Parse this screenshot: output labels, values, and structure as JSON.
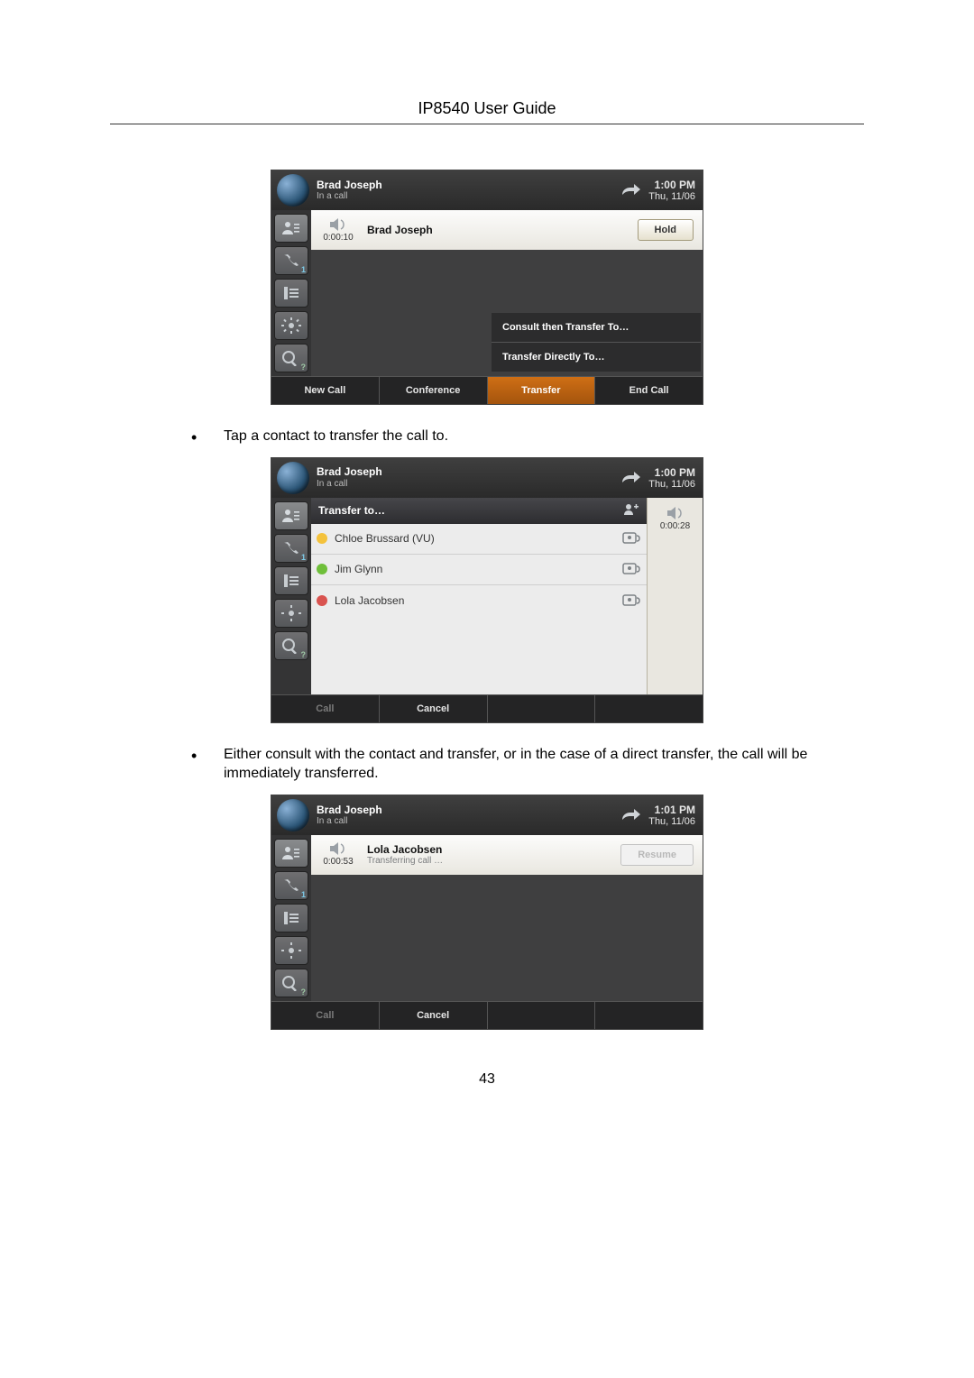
{
  "doc": {
    "title": "IP8540 User Guide",
    "page_number": "43",
    "bullet1": "Tap a contact to transfer the call to.",
    "bullet2": "Either consult with the contact and transfer, or in the case of a direct transfer, the call will be immediately transferred."
  },
  "s1": {
    "presence_name": "Brad Joseph",
    "presence_status": "In a call",
    "time": "1:00 PM",
    "date": "Thu, 11/06",
    "call_timer": "0:00:10",
    "call_name": "Brad Joseph",
    "hold_label": "Hold",
    "menu": {
      "item1": "Consult then Transfer To…",
      "item2": "Transfer Directly To…"
    },
    "softkeys": {
      "k1": "New Call",
      "k2": "Conference",
      "k3": "Transfer",
      "k4": "End Call"
    }
  },
  "s2": {
    "presence_name": "Brad Joseph",
    "presence_status": "In a call",
    "time": "1:00 PM",
    "date": "Thu, 11/06",
    "panel_title": "Transfer to…",
    "call_timer": "0:00:28",
    "contacts": [
      {
        "name": "Chloe Brussard (VU)",
        "status": "away"
      },
      {
        "name": "Jim Glynn",
        "status": "avail"
      },
      {
        "name": "Lola Jacobsen",
        "status": "busy"
      }
    ],
    "softkeys": {
      "k1": "Call",
      "k2": "Cancel"
    }
  },
  "s3": {
    "presence_name": "Brad Joseph",
    "presence_status": "In a call",
    "time": "1:01 PM",
    "date": "Thu, 11/06",
    "call_timer": "0:00:53",
    "call_name": "Lola Jacobsen",
    "call_sub": "Transferring call …",
    "resume_label": "Resume",
    "softkeys": {
      "k1": "Call",
      "k2": "Cancel"
    }
  }
}
